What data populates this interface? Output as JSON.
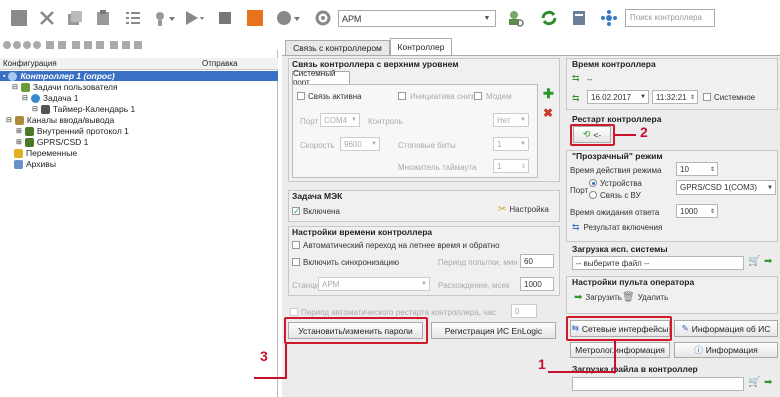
{
  "toolbar": {
    "combo_value": "АРМ",
    "search_placeholder": "Поиск контроллера"
  },
  "tabs": [
    {
      "label": "Связь с контроллером"
    },
    {
      "label": "Контроллер"
    }
  ],
  "tree": {
    "col_config": "Конфигурация",
    "col_sender": "Отправка",
    "nodes": [
      {
        "label": "Контроллер 1 (опрос)"
      },
      {
        "label": "Задачи пользователя"
      },
      {
        "label": "Задача 1"
      },
      {
        "label": "Таймер-Календарь 1"
      },
      {
        "label": "Каналы ввода/вывода"
      },
      {
        "label": "Внутренний протокол 1"
      },
      {
        "label": "GPRS/CSD 1"
      },
      {
        "label": "Переменные"
      },
      {
        "label": "Архивы"
      }
    ]
  },
  "upper_link": {
    "title": "Связь контроллера с верхним уровнем",
    "inner_tab": "Системный порт",
    "active_label": "Связь активна",
    "initiator_label": "Инициатива снизу",
    "modem_label": "Модем",
    "port_label": "Порт",
    "port_value": "COM4",
    "control_label": "Контроль",
    "control_value": "Нет",
    "speed_label": "Скорость",
    "speed_value": "9600",
    "stopbits_label": "Стоповые биты",
    "stopbits_value": "1",
    "timeout_label": "Множитель таймаута",
    "timeout_value": "1"
  },
  "mek": {
    "title": "Задача МЭК",
    "enabled_label": "Включена",
    "settings_label": "Настройка"
  },
  "time_settings": {
    "title": "Настройки времени контроллера",
    "dst_label": "Автоматический переход на летнее время и обратно",
    "sync_label": "Включить синхронизацию",
    "period_label": "Период попытки, мин",
    "period_value": "60",
    "station_label": "Станция",
    "station_value": "АРМ",
    "deviation_label": "Расхождение, мсек",
    "deviation_value": "1000"
  },
  "auto_restart": {
    "label": "Период автоматического рестарта контроллера, час",
    "value": "0"
  },
  "buttons": {
    "set_passwords": "Установить/изменить пароли",
    "register": "Регистрация ИС EnLogic",
    "net_interfaces": "Сетевые интерфейсы",
    "is_info": "Информация об ИС",
    "metrology": "Метролог.информация",
    "info": "Информация"
  },
  "controller_time": {
    "title": "Время контроллера",
    "current": "--",
    "date": "16.02.2017",
    "time": "11:32:21",
    "system_label": "Системное"
  },
  "restart": {
    "title": "Рестарт контроллера",
    "button": "<-"
  },
  "transparent": {
    "title": "\"Прозрачный\" режим",
    "duration_label": "Время действия режима",
    "duration_value": "10",
    "port_label": "Порт",
    "device_label": "Устройства",
    "via_label": "Связь с ВУ",
    "device_value": "GPRS/CSD 1(COM3)",
    "wait_label": "Время ожидания ответа",
    "wait_value": "1000",
    "result_label": "Результат включения"
  },
  "system_load": {
    "title": "Загрузка исп. системы",
    "placeholder": "-- выберите файл --"
  },
  "operator_panel": {
    "title": "Настройки пульта оператора",
    "load": "Загрузить",
    "delete": "Удалить"
  },
  "file_load": {
    "title": "Загрузка файла в контроллер"
  },
  "callouts": [
    "1",
    "2",
    "3"
  ]
}
